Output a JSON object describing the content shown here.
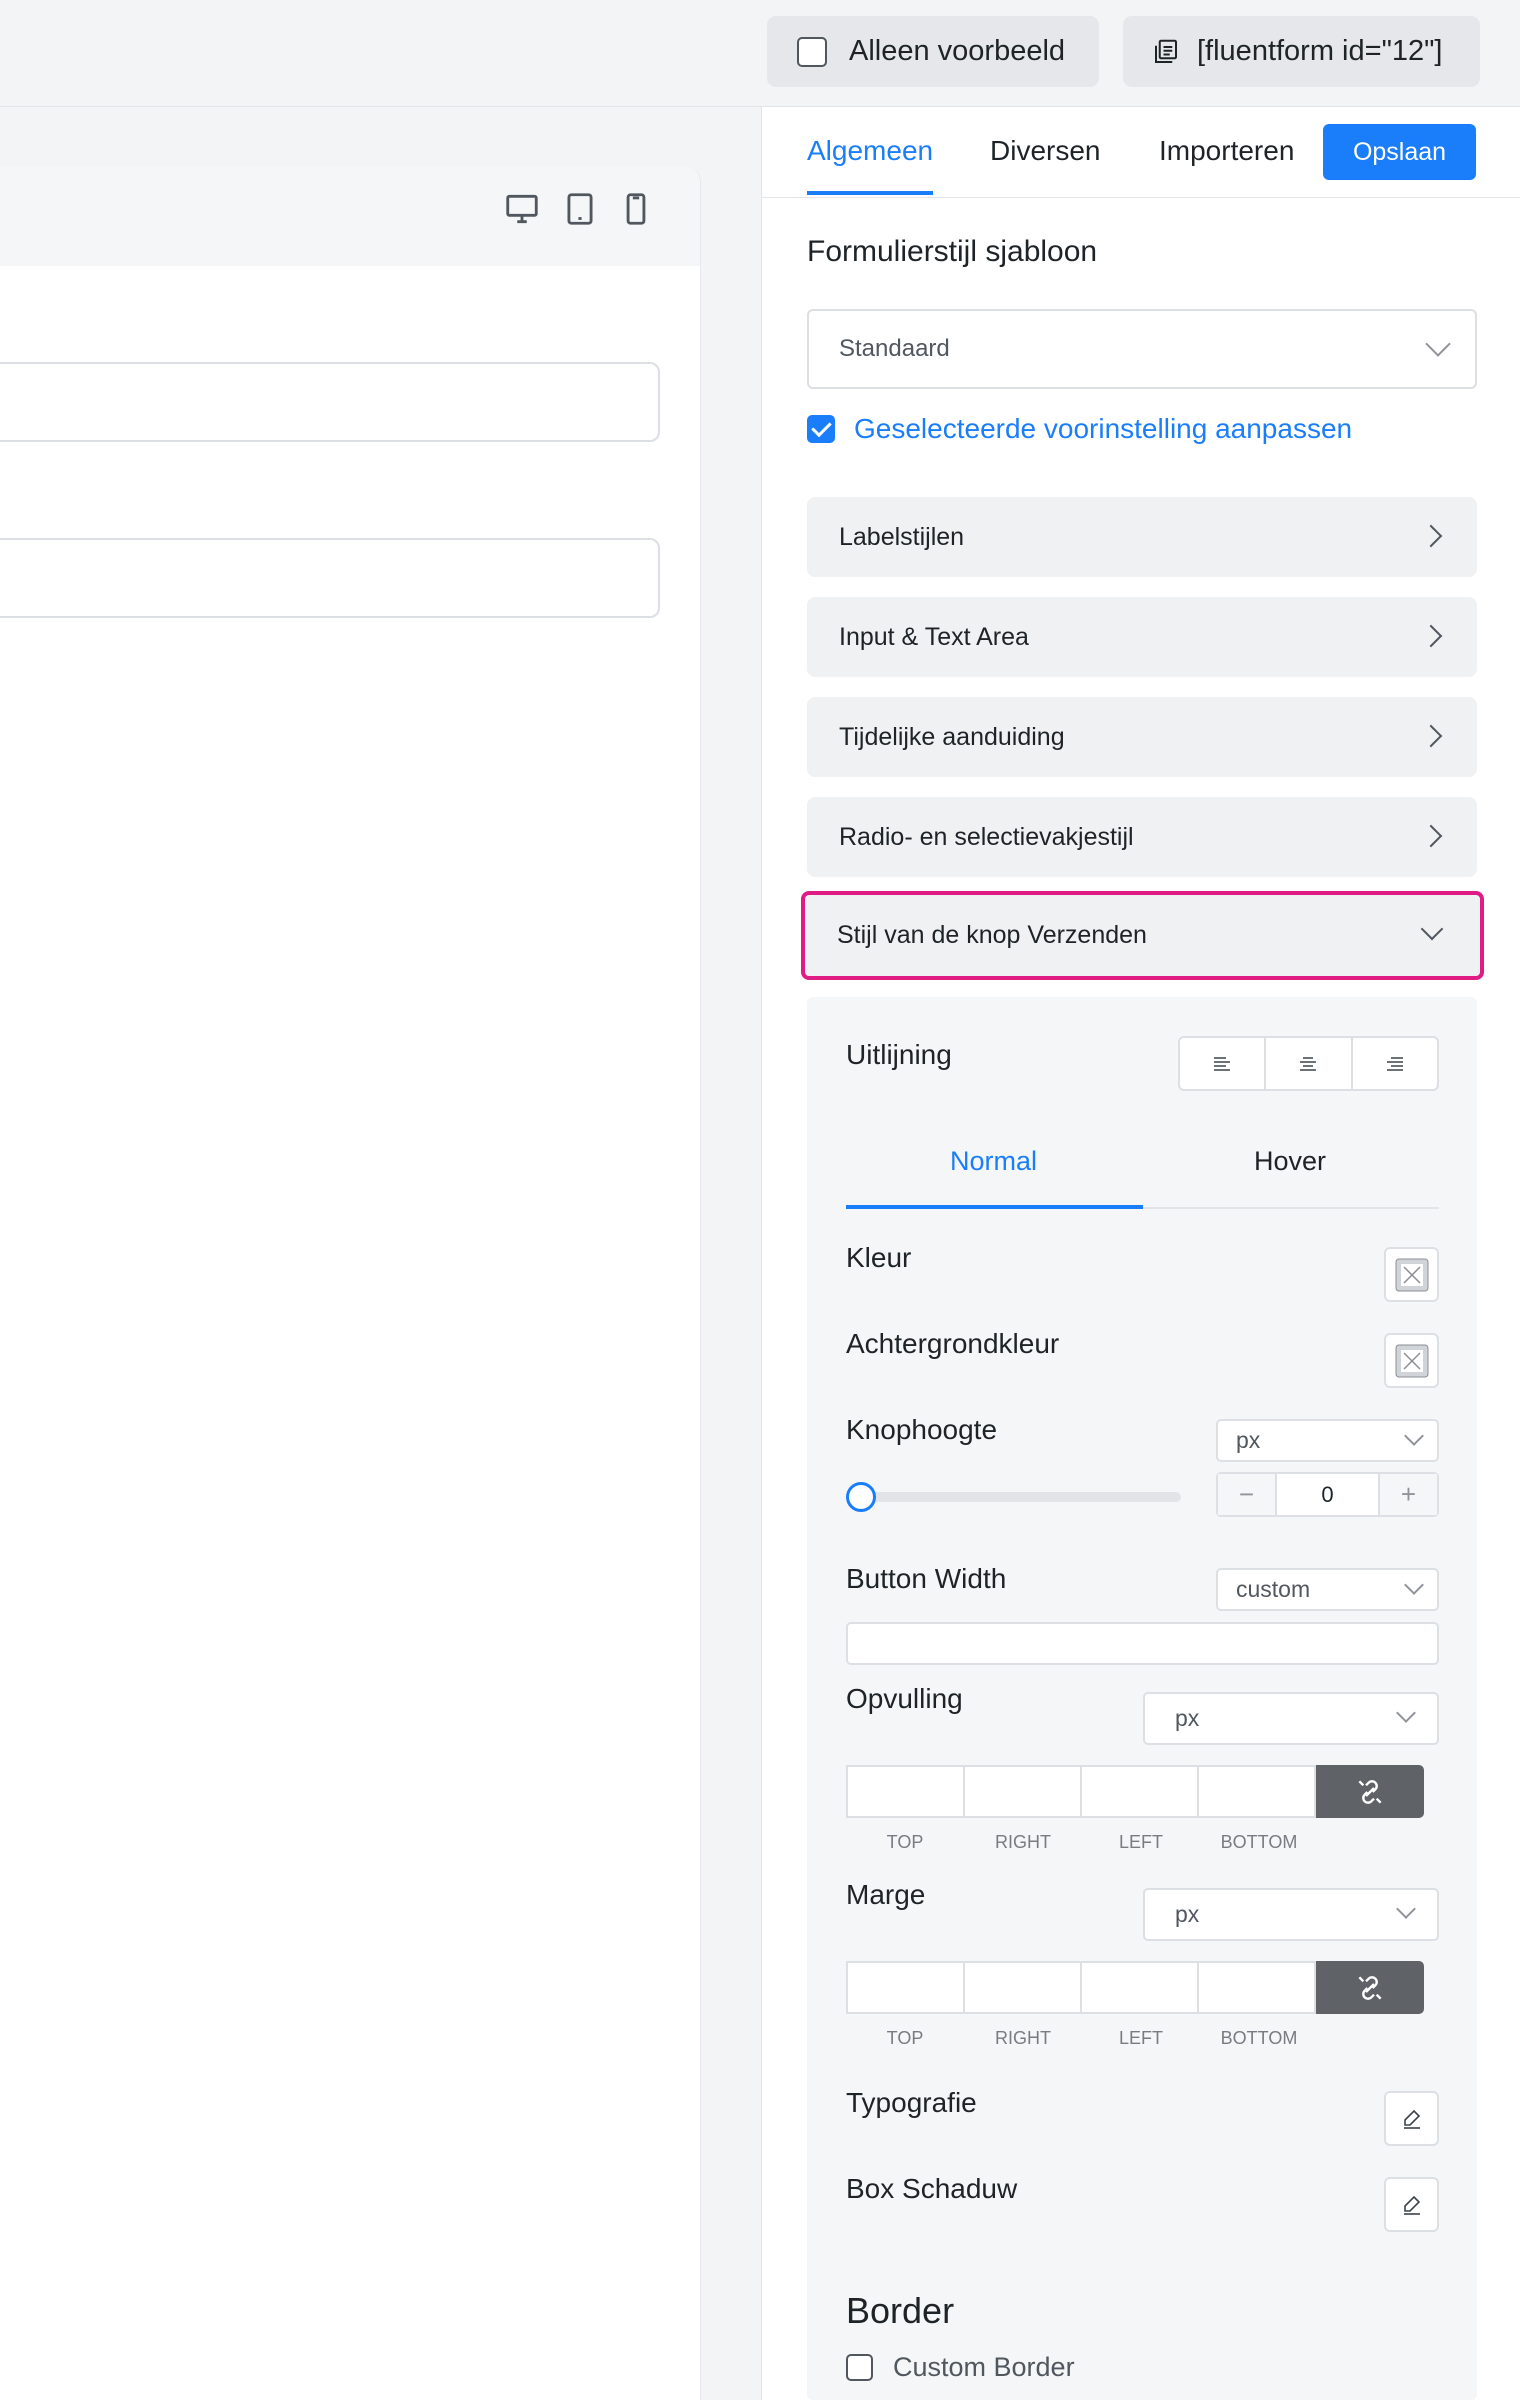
{
  "topbar": {
    "preview_label": "Alleen voorbeeld",
    "shortcode": "[fluentform id=\"12\"]"
  },
  "panel": {
    "tabs": [
      {
        "label": "Algemeen",
        "active": true
      },
      {
        "label": "Diversen",
        "active": false
      },
      {
        "label": "Importeren",
        "active": false
      }
    ],
    "save_label": "Opslaan",
    "section_title": "Formulierstijl sjabloon",
    "template_select": "Standaard",
    "customize_label": "Geselecteerde voorinstelling aanpassen",
    "accordions": [
      {
        "label": "Labelstijlen"
      },
      {
        "label": "Input & Text Area"
      },
      {
        "label": "Tijdelijke aanduiding"
      },
      {
        "label": "Radio- en selectievakjestijl"
      },
      {
        "label": "Stijl van de knop Verzenden",
        "expanded": true
      }
    ],
    "submit_style": {
      "alignment_label": "Uitlijning",
      "state_tabs": [
        {
          "label": "Normal"
        },
        {
          "label": "Hover"
        }
      ],
      "color_label": "Kleur",
      "bg_color_label": "Achtergrondkleur",
      "height_label": "Knophoogte",
      "height_unit": "px",
      "height_value": "0",
      "width_label": "Button Width",
      "width_mode": "custom",
      "padding_label": "Opvulling",
      "padding_unit": "px",
      "margin_label": "Marge",
      "margin_unit": "px",
      "sides": [
        "TOP",
        "RIGHT",
        "LEFT",
        "BOTTOM"
      ],
      "typography_label": "Typografie",
      "box_shadow_label": "Box Schaduw",
      "border_title": "Border",
      "custom_border_label": "Custom Border"
    }
  },
  "colors": {
    "accent": "#1a7efb",
    "highlight": "#e01b84"
  }
}
